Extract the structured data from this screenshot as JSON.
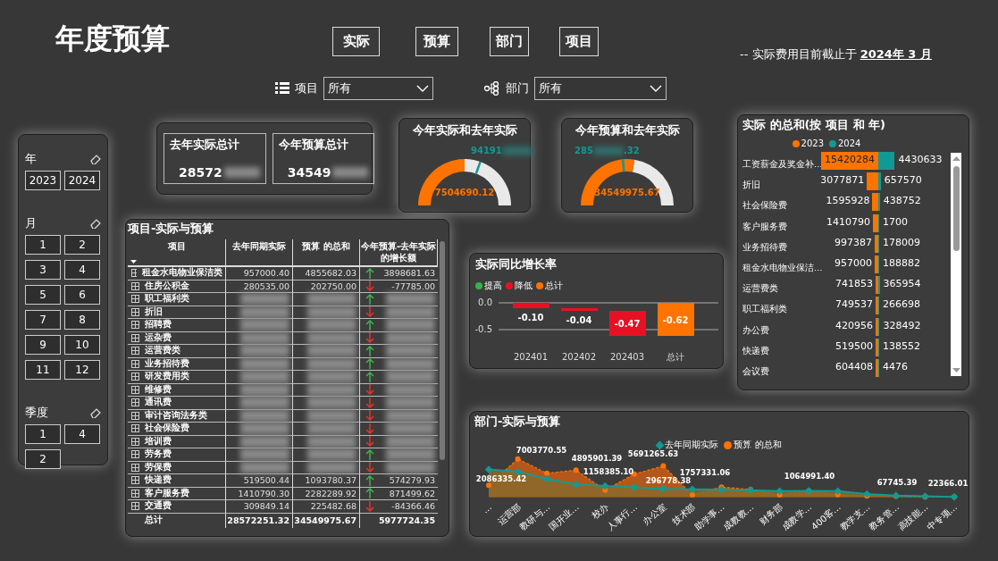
{
  "title": "年度预算",
  "nav_buttons": [
    {
      "label": "实际"
    },
    {
      "label": "预算"
    },
    {
      "label": "部门"
    },
    {
      "label": "项目"
    }
  ],
  "note": "-- 实际费用目前截止于 **2024年 3 月**",
  "filters": [
    {
      "kind": "list",
      "label": "项目",
      "value": "所有"
    },
    {
      "kind": "tree",
      "label": "部门",
      "value": "所有"
    }
  ],
  "slicers": [
    {
      "title": "年",
      "items": [
        {
          "label": "2023",
          "selected": false
        },
        {
          "label": "2024",
          "selected": false
        }
      ]
    },
    {
      "title": "月",
      "items": [
        {
          "label": "1",
          "selected": false
        },
        {
          "label": "2",
          "selected": false
        },
        {
          "label": "3",
          "selected": false
        },
        {
          "label": "4",
          "selected": false
        },
        {
          "label": "5",
          "selected": false
        },
        {
          "label": "6",
          "selected": false
        },
        {
          "label": "7",
          "selected": false
        },
        {
          "label": "8",
          "selected": false
        },
        {
          "label": "9",
          "selected": false
        },
        {
          "label": "10",
          "selected": false
        },
        {
          "label": "11",
          "selected": false
        },
        {
          "label": "12",
          "selected": false
        }
      ]
    },
    {
      "title": "季度",
      "items": [
        {
          "label": "1",
          "selected": false
        },
        {
          "label": "4",
          "selected": false
        },
        {
          "label": "2",
          "selected": false
        }
      ]
    }
  ],
  "kpis": [
    {
      "title": "去年实际总计",
      "value": "28572"
    },
    {
      "title": "今年预算总计",
      "value": "34549"
    }
  ],
  "gauges": [
    {
      "title": "今年实际和去年实际",
      "value": "7504690.12",
      "level": 0.5,
      "target_label": [
        "94191"
      ],
      "target": {
        "level": 0.61
      }
    },
    {
      "title": "今年预算和去年实际",
      "value": "34549975.67",
      "level": 0.55,
      "target_label": [
        "285",
        ".32"
      ],
      "target": {
        "level": 0.47
      }
    }
  ],
  "bar_chart": {
    "title": "实际 的总和(按 项目 和 年)",
    "legend": [
      {
        "name": "2023",
        "color": "#ff7300"
      },
      {
        "name": "2024",
        "color": "#119a94"
      }
    ],
    "rows": [
      {
        "category": "工资薪金及奖金补…",
        "labels": [
          "15420284",
          "4430633"
        ]
      },
      {
        "category": "折旧",
        "labels": [
          "3077871",
          "657570"
        ]
      },
      {
        "category": "社会保险费",
        "labels": [
          "1595928",
          "438752"
        ]
      },
      {
        "category": "客户服务费",
        "labels": [
          "1410790",
          "1700"
        ]
      },
      {
        "category": "业务招待费",
        "labels": [
          "997387",
          "178009"
        ]
      },
      {
        "category": "租金水电物业保洁…",
        "labels": [
          "957000",
          "188882"
        ]
      },
      {
        "category": "运营费类",
        "labels": [
          "741853",
          "365954"
        ]
      },
      {
        "category": "职工福利类",
        "labels": [
          "749537",
          "266698"
        ]
      },
      {
        "category": "办公费",
        "labels": [
          "420956",
          "328492"
        ]
      },
      {
        "category": "快递费",
        "labels": [
          "519500",
          "138552"
        ]
      },
      {
        "category": "会议费",
        "labels": [
          "604408",
          "4476"
        ]
      }
    ]
  },
  "table": {
    "title": "项目-实际与预算",
    "columns": [
      "项目",
      "去年同期实际",
      "预算 的总和",
      "今年预算-去年实际的增长额"
    ],
    "rows": [
      {
        "name": "租金水电物业保洁类",
        "last_year": "957000.40",
        "budget": "4855682.03",
        "growth": "3898681.63",
        "increase": true
      },
      {
        "name": "住房公积金",
        "last_year": "280535.00",
        "budget": "202750.00",
        "growth": "-77785.00",
        "increase": false
      },
      {
        "name": "职工福利类",
        "increase": true,
        "blurred": true
      },
      {
        "name": "折旧",
        "increase": false,
        "blurred": true
      },
      {
        "name": "招聘费",
        "increase": true,
        "blurred": true
      },
      {
        "name": "运杂费",
        "increase": false,
        "blurred": true
      },
      {
        "name": "运营费类",
        "increase": true,
        "blurred": true
      },
      {
        "name": "业务招待费",
        "increase": true,
        "blurred": true
      },
      {
        "name": "研发费用类",
        "increase": true,
        "blurred": true
      },
      {
        "name": "维修费",
        "increase": false,
        "blurred": true
      },
      {
        "name": "通讯费",
        "increase": false,
        "blurred": true
      },
      {
        "name": "审计咨询法务类",
        "increase": false,
        "blurred": true
      },
      {
        "name": "社会保险费",
        "increase": false,
        "blurred": true
      },
      {
        "name": "培训费",
        "increase": false,
        "blurred": true
      },
      {
        "name": "劳务费",
        "increase": true,
        "blurred": true
      },
      {
        "name": "劳保费",
        "increase": false,
        "blurred": true
      },
      {
        "name": "快递费",
        "last_year": "519500.44",
        "budget": "1093780.37",
        "growth": "574279.93",
        "increase": true
      },
      {
        "name": "客户服务费",
        "last_year": "1410790.30",
        "budget": "2282289.92",
        "growth": "871499.62",
        "increase": true
      },
      {
        "name": "交通费",
        "last_year": "309849.14",
        "budget": "225482.68",
        "growth": "-84366.46",
        "increase": false
      }
    ],
    "total": {
      "name": "总计",
      "last_year": "28572251.32",
      "budget": "34549975.67",
      "growth": "5977724.35"
    }
  },
  "waterfall": {
    "legend": [
      {
        "label": "提高",
        "color": "#37b34a"
      },
      {
        "label": "降低",
        "color": "#e81123"
      },
      {
        "label": "总计",
        "color": "#ff7300"
      }
    ],
    "title": "实际同比增长率",
    "tick_labels": [
      "0.0",
      "-0.5"
    ],
    "bars": [
      {
        "kind": "decrease",
        "category": "202401",
        "value_label": "-0.10"
      },
      {
        "kind": "decrease",
        "category": "202402",
        "value_label": "-0.04"
      },
      {
        "kind": "decrease",
        "category": "202403",
        "value_label": "-0.47"
      },
      {
        "kind": "total",
        "category": "总计",
        "value_label": "-0.62"
      }
    ]
  },
  "dept_chart": {
    "title": "部门-实际与预算",
    "legend": [
      {
        "label": "去年同期实际",
        "color": "#119a94"
      },
      {
        "label": "预算 的总和",
        "color": "#ff7300"
      }
    ],
    "categories": [
      "…",
      "运营部",
      "教研与…",
      "国开业…",
      "校办",
      "人事行…",
      "办公室",
      "技术部",
      "助学事…",
      "成教教…",
      "财务部",
      "成教学…",
      "400客…",
      "教学支…",
      "教务管…",
      "高技能…",
      "中专项…"
    ],
    "value_labels": [
      "2086335.42",
      "7003770.55",
      "4895901.39",
      "1158385.10",
      "5691265.63",
      "296778.38",
      "1757331.06",
      "1064991.40",
      "67745.39",
      "22366.01"
    ]
  }
}
